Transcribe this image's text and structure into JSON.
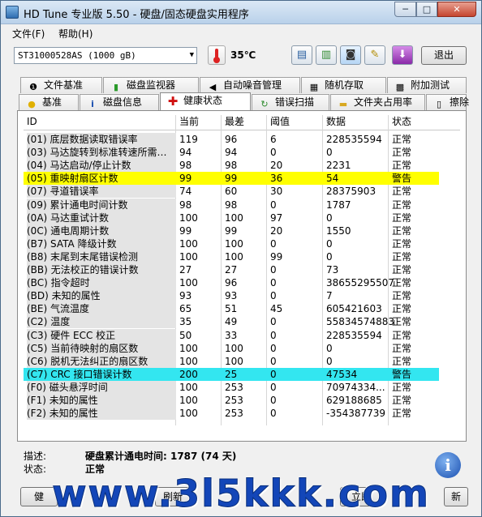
{
  "window": {
    "title": "HD Tune 专业版 5.50 - 硬盘/固态硬盘实用程序",
    "min_label": "─",
    "max_label": "□",
    "close_label": "✕"
  },
  "menu": {
    "items": [
      {
        "label": "文件(F)"
      },
      {
        "label": "帮助(H)"
      }
    ]
  },
  "toolbar": {
    "drive": "ST31000528AS (1000 gB)",
    "temperature": "35℃",
    "exit_label": "退出",
    "buttons": [
      {
        "icon": "copy-icon",
        "glyph": "▤"
      },
      {
        "icon": "copy-green-icon",
        "glyph": "▥"
      },
      {
        "icon": "camera-icon",
        "glyph": "◙"
      },
      {
        "icon": "tools-icon",
        "glyph": "✎"
      },
      {
        "icon": "download-icon",
        "glyph": "⬇"
      }
    ]
  },
  "tabs_top": [
    {
      "label": "文件基准",
      "icon": "benchmark-icon",
      "glyph": "❶"
    },
    {
      "label": "磁盘监视器",
      "icon": "monitor-icon",
      "glyph": "▮"
    },
    {
      "label": "自动噪音管理",
      "icon": "speaker-icon",
      "glyph": "◀"
    },
    {
      "label": "随机存取",
      "icon": "random-icon",
      "glyph": "▦"
    },
    {
      "label": "附加测试",
      "icon": "extra-test-icon",
      "glyph": "▩"
    }
  ],
  "tabs_bottom": [
    {
      "label": "基准",
      "icon": "lightbulb-icon",
      "glyph": "●"
    },
    {
      "label": "磁盘信息",
      "icon": "info-small-icon",
      "glyph": "i"
    },
    {
      "label": "健康状态",
      "icon": "health-cross-icon",
      "glyph": "✚"
    },
    {
      "label": "错误扫描",
      "icon": "scan-icon",
      "glyph": "↻"
    },
    {
      "label": "文件夹占用率",
      "icon": "folder-icon",
      "glyph": "▬"
    },
    {
      "label": "擦除",
      "icon": "trash-icon",
      "glyph": "▯"
    }
  ],
  "active_tab": "健康状态",
  "table": {
    "headers": {
      "id": "ID",
      "current": "当前",
      "worst": "最差",
      "threshold": "阈值",
      "data": "数据",
      "status": "状态"
    },
    "rows": [
      {
        "id": "(01) 底层数据读取错误率",
        "current": "119",
        "worst": "96",
        "threshold": "6",
        "data": "228535594",
        "status": "正常",
        "highlight": ""
      },
      {
        "id": "(03) 马达旋转到标准转速所需…",
        "current": "94",
        "worst": "94",
        "threshold": "0",
        "data": "0",
        "status": "正常",
        "highlight": ""
      },
      {
        "id": "(04) 马达启动/停止计数",
        "current": "98",
        "worst": "98",
        "threshold": "20",
        "data": "2231",
        "status": "正常",
        "highlight": ""
      },
      {
        "id": "(05) 重映射扇区计数",
        "current": "99",
        "worst": "99",
        "threshold": "36",
        "data": "54",
        "status": "警告",
        "highlight": "#ffff00"
      },
      {
        "id": "(07) 寻道错误率",
        "current": "74",
        "worst": "60",
        "threshold": "30",
        "data": "28375903",
        "status": "正常",
        "highlight": ""
      },
      {
        "id": "(09) 累计通电时间计数",
        "current": "98",
        "worst": "98",
        "threshold": "0",
        "data": "1787",
        "status": "正常",
        "highlight": ""
      },
      {
        "id": "(0A) 马达重试计数",
        "current": "100",
        "worst": "100",
        "threshold": "97",
        "data": "0",
        "status": "正常",
        "highlight": ""
      },
      {
        "id": "(0C) 通电周期计数",
        "current": "99",
        "worst": "99",
        "threshold": "20",
        "data": "1550",
        "status": "正常",
        "highlight": ""
      },
      {
        "id": "(B7) SATA 降级计数",
        "current": "100",
        "worst": "100",
        "threshold": "0",
        "data": "0",
        "status": "正常",
        "highlight": ""
      },
      {
        "id": "(B8) 末尾到末尾错误检测",
        "current": "100",
        "worst": "100",
        "threshold": "99",
        "data": "0",
        "status": "正常",
        "highlight": ""
      },
      {
        "id": "(BB) 无法校正的错误计数",
        "current": "27",
        "worst": "27",
        "threshold": "0",
        "data": "73",
        "status": "正常",
        "highlight": ""
      },
      {
        "id": "(BC) 指令超时",
        "current": "100",
        "worst": "96",
        "threshold": "0",
        "data": "38655295507",
        "status": "正常",
        "highlight": ""
      },
      {
        "id": "(BD) 未知的属性",
        "current": "93",
        "worst": "93",
        "threshold": "0",
        "data": "7",
        "status": "正常",
        "highlight": ""
      },
      {
        "id": "(BE) 气流温度",
        "current": "65",
        "worst": "51",
        "threshold": "45",
        "data": "605421603",
        "status": "正常",
        "highlight": ""
      },
      {
        "id": "(C2) 温度",
        "current": "35",
        "worst": "49",
        "threshold": "0",
        "data": "55834574883",
        "status": "正常",
        "highlight": ""
      },
      {
        "id": "(C3) 硬件 ECC 校正",
        "current": "50",
        "worst": "33",
        "threshold": "0",
        "data": "228535594",
        "status": "正常",
        "highlight": ""
      },
      {
        "id": "(C5) 当前待映射的扇区数",
        "current": "100",
        "worst": "100",
        "threshold": "0",
        "data": "0",
        "status": "正常",
        "highlight": ""
      },
      {
        "id": "(C6) 脱机无法纠正的扇区数",
        "current": "100",
        "worst": "100",
        "threshold": "0",
        "data": "0",
        "status": "正常",
        "highlight": ""
      },
      {
        "id": "(C7) CRC 接口错误计数",
        "current": "200",
        "worst": "25",
        "threshold": "0",
        "data": "47534",
        "status": "警告",
        "highlight": "#33e6f0"
      },
      {
        "id": "(F0) 磁头悬浮时间",
        "current": "100",
        "worst": "253",
        "threshold": "0",
        "data": "70974334...",
        "status": "正常",
        "highlight": ""
      },
      {
        "id": "(F1) 未知的属性",
        "current": "100",
        "worst": "253",
        "threshold": "0",
        "data": "629188685",
        "status": "正常",
        "highlight": ""
      },
      {
        "id": "(F2) 未知的属性",
        "current": "100",
        "worst": "253",
        "threshold": "0",
        "data": "-354387739",
        "status": "正常",
        "highlight": ""
      }
    ]
  },
  "footer": {
    "desc_label": "描述:",
    "desc_value": "硬盘累计通电时间: 1787 (74 天)",
    "status_label": "状态:",
    "status_value": "正常",
    "btn_save_partial": "健",
    "btn_refresh_partial": "刷新",
    "btn_update_partial": "立即",
    "btn_last_partial": "新"
  },
  "watermark": "www.3l5kkk.com"
}
